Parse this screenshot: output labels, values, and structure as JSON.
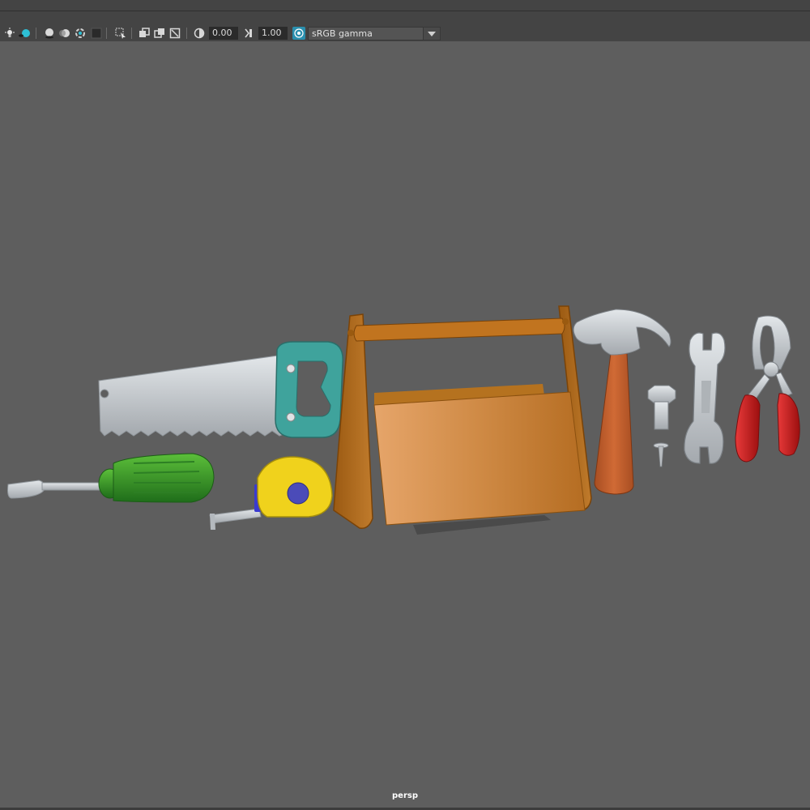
{
  "toolbar": {
    "icons": [
      "light-icon",
      "shadow-icon",
      "ao-icon",
      "motion-blur-icon",
      "anti-alias-icon",
      "isolate-icon",
      "select-icon",
      "xray-icon",
      "xray-joints-icon",
      "backface-icon",
      "exposure-icon",
      "gamma-icon",
      "color-management-icon"
    ],
    "exposure_value": "0.00",
    "gamma_value": "1.00",
    "color_space": "sRGB gamma"
  },
  "viewport": {
    "camera": "persp",
    "background_color": "#5e5e5e",
    "objects": [
      "saw",
      "screwdriver",
      "tape-measure",
      "toolbox",
      "hammer",
      "bolt",
      "nail",
      "wrench",
      "pliers"
    ]
  },
  "colors": {
    "toolbar_bg": "#444444",
    "accent": "#2a8fae",
    "saw_handle": "#3fa39c",
    "screwdriver_handle": "#3e9a2c",
    "tape_body": "#f0d21c",
    "toolbox": "#c9843a",
    "hammer_handle": "#c2602e",
    "pliers_grip": "#cc1f1f",
    "metal": "#c7cbd0"
  }
}
